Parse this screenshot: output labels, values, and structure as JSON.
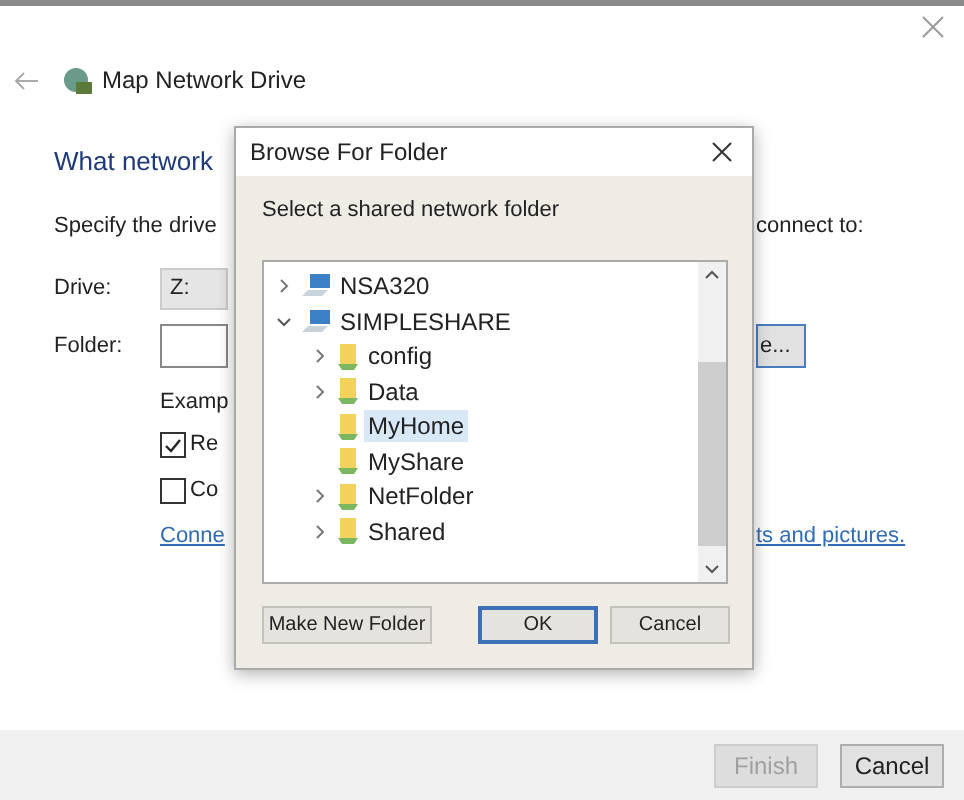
{
  "wizard": {
    "title": "Map Network Drive",
    "heading": "What network",
    "instruction_left": "Specify the drive",
    "instruction_right": "connect to:",
    "drive_label": "Drive:",
    "drive_value": "Z:",
    "folder_label": "Folder:",
    "browse_button": "e...",
    "example": "Examp",
    "options": [
      {
        "label": "Re",
        "checked": true
      },
      {
        "label": "Co",
        "checked": false
      }
    ],
    "link_left": "Conne",
    "link_right": "ts and pictures.",
    "buttons": [
      {
        "label": "Finish",
        "disabled": true
      },
      {
        "label": "Cancel",
        "disabled": false
      }
    ]
  },
  "dialog": {
    "title": "Browse For Folder",
    "prompt": "Select a shared network folder",
    "tree": [
      {
        "label": "NSA320",
        "kind": "computer",
        "expanded": false,
        "selected": false
      },
      {
        "label": "SIMPLESHARE",
        "kind": "computer",
        "expanded": true,
        "selected": false,
        "children": [
          {
            "label": "config",
            "kind": "folder",
            "expanded": false,
            "selected": false
          },
          {
            "label": "Data",
            "kind": "folder",
            "expanded": false,
            "selected": false
          },
          {
            "label": "MyHome",
            "kind": "folder",
            "selected": true
          },
          {
            "label": "MyShare",
            "kind": "folder",
            "selected": false
          },
          {
            "label": "NetFolder",
            "kind": "folder",
            "expanded": false,
            "selected": false
          },
          {
            "label": "Shared",
            "kind": "folder",
            "expanded": false,
            "selected": false
          }
        ]
      }
    ],
    "buttons": [
      {
        "label": "Make New Folder",
        "default": false
      },
      {
        "label": "OK",
        "default": true
      },
      {
        "label": "Cancel",
        "default": false
      }
    ]
  }
}
